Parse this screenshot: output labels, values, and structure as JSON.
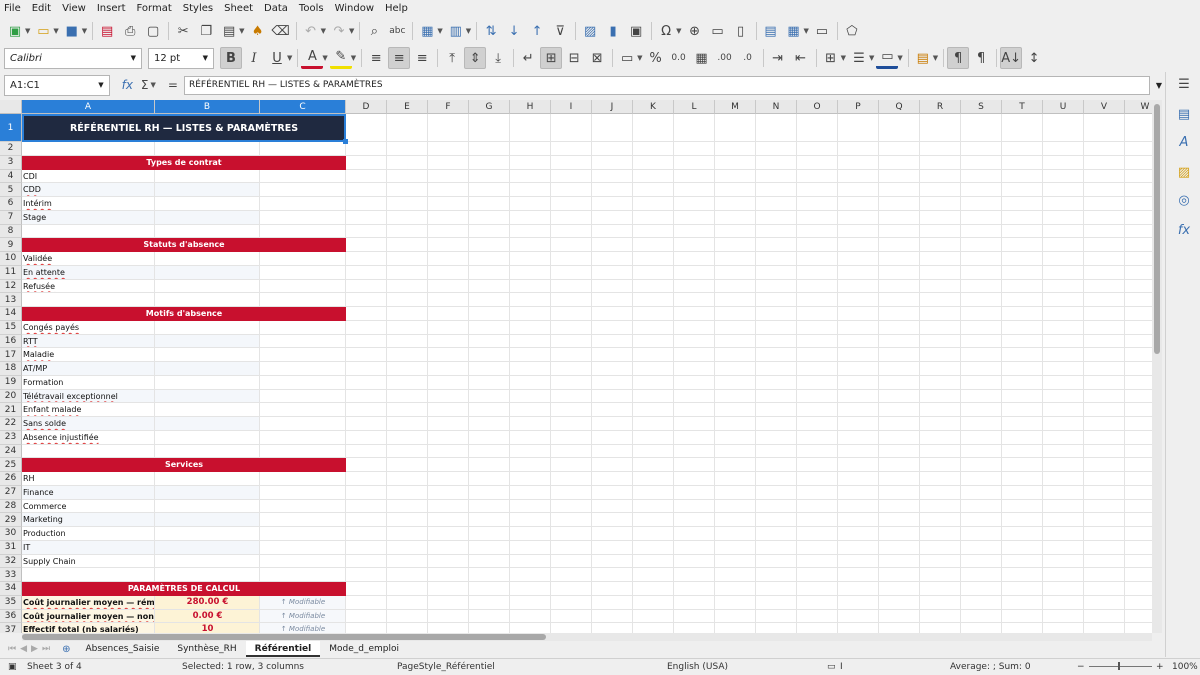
{
  "menu": [
    "File",
    "Edit",
    "View",
    "Insert",
    "Format",
    "Styles",
    "Sheet",
    "Data",
    "Tools",
    "Window",
    "Help"
  ],
  "format": {
    "font_name": "Calibri",
    "font_size": "12 pt"
  },
  "formula_bar": {
    "name_box": "A1:C1",
    "content": "RÉFÉRENTIEL RH — LISTES & PARAMÈTRES"
  },
  "columns": [
    "A",
    "B",
    "C",
    "D",
    "E",
    "F",
    "G",
    "H",
    "I",
    "J",
    "K",
    "L",
    "M",
    "N",
    "O",
    "P",
    "Q",
    "R",
    "S",
    "T",
    "U",
    "V",
    "W"
  ],
  "rows": [
    "1",
    "2",
    "3",
    "4",
    "5",
    "6",
    "7",
    "8",
    "9",
    "10",
    "11",
    "12",
    "13",
    "14",
    "15",
    "16",
    "17",
    "18",
    "19",
    "20",
    "21",
    "22",
    "23",
    "24",
    "25",
    "26",
    "27",
    "28",
    "29",
    "30",
    "31",
    "32",
    "33",
    "34",
    "35",
    "36",
    "37"
  ],
  "sheet": {
    "title": "RÉFÉRENTIEL RH — LISTES & PARAMÈTRES",
    "contrat_header": "Types de contrat",
    "contrat": [
      "CDI",
      "CDD",
      "Intérim",
      "Stage"
    ],
    "statuts_header": "Statuts d'absence",
    "statuts": [
      "Validée",
      "En attente",
      "Refusée"
    ],
    "motifs_header": "Motifs d'absence",
    "motifs": [
      "Congés payés",
      "RTT",
      "Maladie",
      "AT/MP",
      "Formation",
      "Télétravail exceptionnel",
      "Enfant malade",
      "Sans solde",
      "Absence injustifiée"
    ],
    "services_header": "Services",
    "services": [
      "RH",
      "Finance",
      "Commerce",
      "Marketing",
      "Production",
      "IT",
      "Supply Chain"
    ],
    "params_header": "PARAMÈTRES DE CALCUL",
    "params": [
      {
        "label": "Coût journalier moyen — rémunéré",
        "value": "280.00 €",
        "note": "↑ Modifiable"
      },
      {
        "label": "Coût journalier moyen — non rémunéré",
        "value": "0.00 €",
        "note": "↑ Modifiable"
      },
      {
        "label": "Effectif total (nb salariés)",
        "value": "10",
        "note": "↑ Modifiable"
      }
    ]
  },
  "tabs": [
    "Absences_Saisie",
    "Synthèse_RH",
    "Référentiel",
    "Mode_d_emploi"
  ],
  "active_tab": "Référentiel",
  "status": {
    "sheet": "Sheet 3 of 4",
    "selection": "Selected: 1 row, 3 columns",
    "page_style": "PageStyle_Référentiel",
    "language": "English (USA)",
    "sum": "Average: ; Sum: 0",
    "zoom": "100%"
  }
}
